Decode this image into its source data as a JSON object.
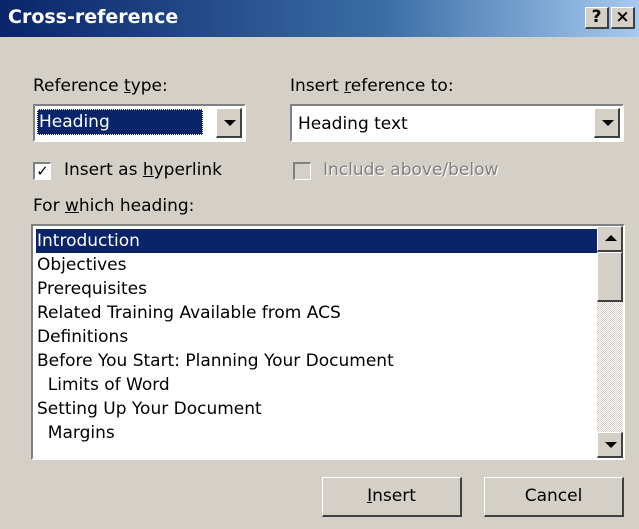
{
  "window": {
    "title": "Cross-reference",
    "help_label": "?",
    "close_label": "×"
  },
  "reference_type": {
    "label_pre": "Reference ",
    "label_accel": "t",
    "label_post": "ype:",
    "value": "Heading"
  },
  "insert_reference_to": {
    "label_pre": "Insert ",
    "label_accel": "r",
    "label_post": "eference to:",
    "value": "Heading text"
  },
  "insert_as_hyperlink": {
    "label_pre": "Insert as ",
    "label_accel": "h",
    "label_post": "yperlink",
    "checked": true,
    "check_glyph": "✓"
  },
  "include_above_below": {
    "label": "Include above/below",
    "checked": false,
    "enabled": false
  },
  "for_which_heading": {
    "label_pre": "For ",
    "label_accel": "w",
    "label_post": "hich heading:",
    "items": [
      {
        "text": "Introduction",
        "selected": true
      },
      {
        "text": "Objectives",
        "selected": false
      },
      {
        "text": "Prerequisites",
        "selected": false
      },
      {
        "text": "Related Training Available from ACS",
        "selected": false
      },
      {
        "text": "Definitions",
        "selected": false
      },
      {
        "text": "Before You Start: Planning Your Document",
        "selected": false
      },
      {
        "text": "  Limits of Word",
        "selected": false
      },
      {
        "text": "Setting Up Your Document",
        "selected": false
      },
      {
        "text": "  Margins",
        "selected": false
      }
    ]
  },
  "buttons": {
    "insert_accel": "I",
    "insert_rest": "nsert",
    "cancel": "Cancel"
  }
}
